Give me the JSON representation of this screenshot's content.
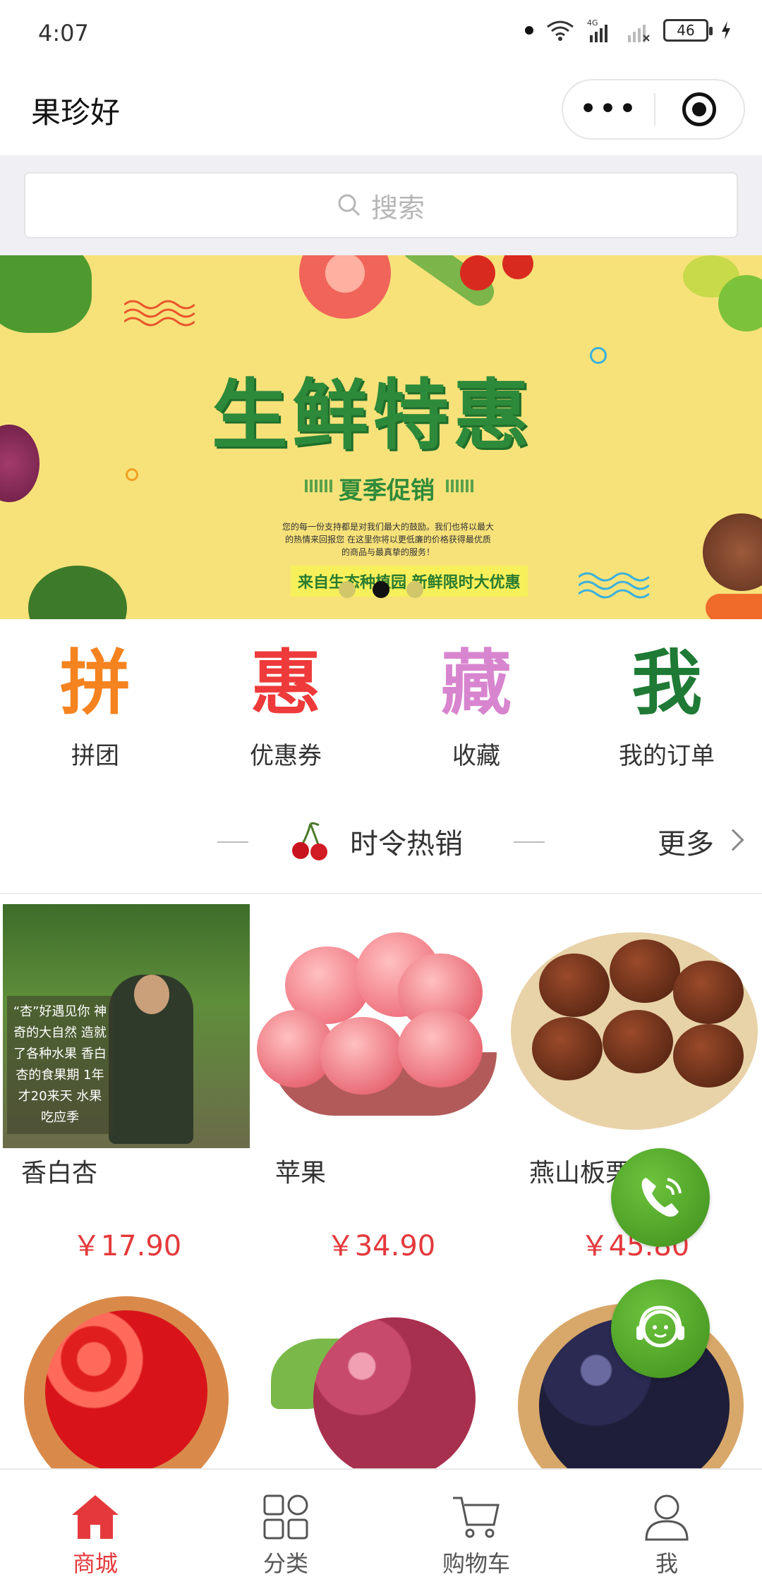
{
  "status_bar": {
    "time": "4:07",
    "network": "4G",
    "battery": "46"
  },
  "header": {
    "title": "果珍好",
    "more_icon": "more-dots-icon",
    "close_icon": "target-icon"
  },
  "search": {
    "placeholder": "搜索"
  },
  "banner": {
    "title": "生鲜特惠",
    "subtitle": "夏季促销",
    "fine_print": "您的每一份支持都是对我们最大的鼓励。我们也将以最大的热情来回报您 在这里你将以更低廉的价格获得最优质的商品与最真挚的服务！",
    "tagline": "来自生态种植园 新鲜限时大优惠",
    "pages": 3,
    "active_page": 2
  },
  "quick_menu": [
    {
      "label": "拼团",
      "glyph": "拼",
      "color": "#f5831f"
    },
    {
      "label": "优惠券",
      "glyph": "惠",
      "color": "#ee3a3a"
    },
    {
      "label": "收藏",
      "glyph": "藏",
      "color": "#d885cf"
    },
    {
      "label": "我的订单",
      "glyph": "我",
      "color": "#1f7a35"
    }
  ],
  "section": {
    "title": "时令热销",
    "more": "更多"
  },
  "products": [
    {
      "name": "香白杏",
      "price": "￥17.90",
      "caption": "“杏”好遇见你 神奇的大自然 造就了各种水果 香白杏的食果期 1年才20来天 水果吃应季"
    },
    {
      "name": "苹果",
      "price": "￥34.90"
    },
    {
      "name": "燕山板栗",
      "price": "￥45.80"
    },
    {
      "name": "",
      "price": ""
    },
    {
      "name": "",
      "price": ""
    },
    {
      "name": "",
      "price": ""
    }
  ],
  "floating": {
    "phone_icon": "phone-icon",
    "service_icon": "customer-service-icon"
  },
  "tabbar": [
    {
      "label": "商城",
      "active": true
    },
    {
      "label": "分类",
      "active": false
    },
    {
      "label": "购物车",
      "active": false
    },
    {
      "label": "我",
      "active": false
    }
  ],
  "colors": {
    "accent": "#e4393c",
    "banner_bg": "#f7e27a",
    "fab_green": "#4fa126"
  }
}
